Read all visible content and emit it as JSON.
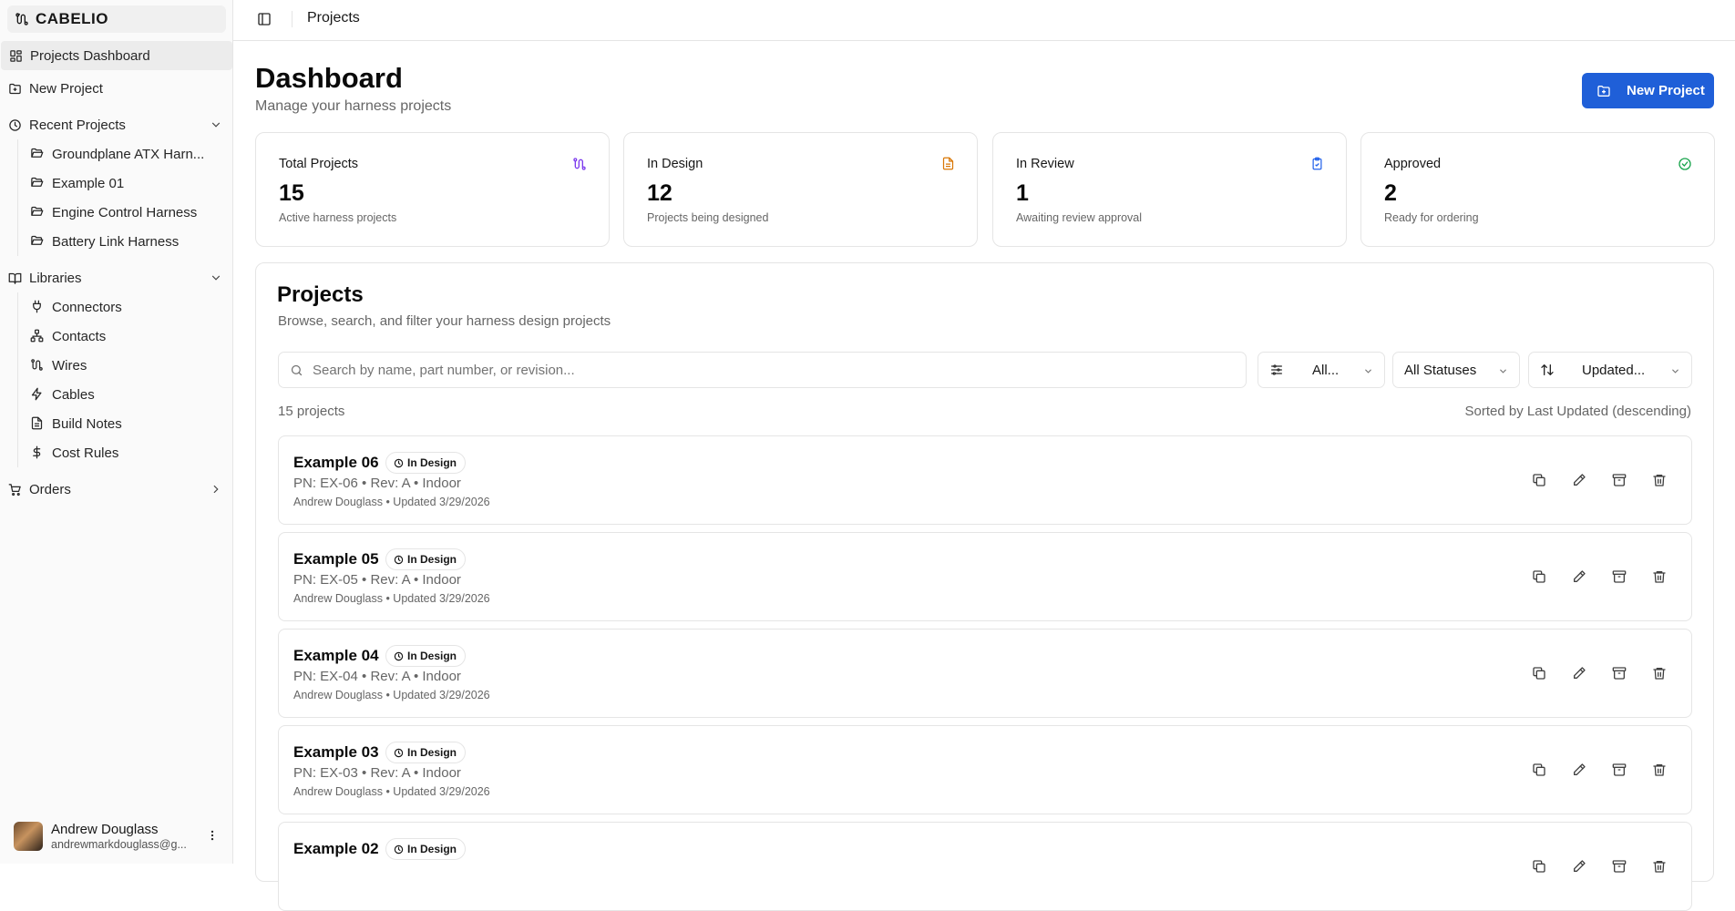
{
  "app": {
    "brand": "CABELIO"
  },
  "sidebar": {
    "nav": {
      "dashboard": "Projects Dashboard",
      "new_project": "New Project",
      "recent": "Recent Projects",
      "libraries": "Libraries",
      "orders": "Orders"
    },
    "recent_projects": [
      "Groundplane ATX Harn...",
      "Example 01",
      "Engine Control Harness",
      "Battery Link Harness"
    ],
    "libraries": [
      "Connectors",
      "Contacts",
      "Wires",
      "Cables",
      "Build Notes",
      "Cost Rules"
    ],
    "user": {
      "name": "Andrew Douglass",
      "email": "andrewmarkdouglass@g..."
    }
  },
  "topbar": {
    "breadcrumb": "Projects"
  },
  "header": {
    "title": "Dashboard",
    "subtitle": "Manage your harness projects",
    "new_button": "New Project"
  },
  "stats": [
    {
      "label": "Total Projects",
      "value": "15",
      "desc": "Active harness projects",
      "icon": "wiring-icon",
      "color": "#7c3aed"
    },
    {
      "label": "In Design",
      "value": "12",
      "desc": "Projects being designed",
      "icon": "document-icon",
      "color": "#d97706"
    },
    {
      "label": "In Review",
      "value": "1",
      "desc": "Awaiting review approval",
      "icon": "clipboard-check-icon",
      "color": "#2563eb"
    },
    {
      "label": "Approved",
      "value": "2",
      "desc": "Ready for ordering",
      "icon": "check-circle-icon",
      "color": "#16a34a"
    }
  ],
  "projects_panel": {
    "title": "Projects",
    "subtitle": "Browse, search, and filter your harness design projects",
    "search_placeholder": "Search by name, part number, or revision...",
    "filter_type": "All...",
    "filter_status": "All Statuses",
    "sort": "Updated...",
    "count": "15 projects",
    "sorted_by": "Sorted by Last Updated (descending)"
  },
  "projects": [
    {
      "name": "Example 06",
      "status": "In Design",
      "meta": "PN: EX-06 • Rev: A • Indoor",
      "footer": "Andrew Douglass • Updated 3/29/2026"
    },
    {
      "name": "Example 05",
      "status": "In Design",
      "meta": "PN: EX-05 • Rev: A • Indoor",
      "footer": "Andrew Douglass • Updated 3/29/2026"
    },
    {
      "name": "Example 04",
      "status": "In Design",
      "meta": "PN: EX-04 • Rev: A • Indoor",
      "footer": "Andrew Douglass • Updated 3/29/2026"
    },
    {
      "name": "Example 03",
      "status": "In Design",
      "meta": "PN: EX-03 • Rev: A • Indoor",
      "footer": "Andrew Douglass • Updated 3/29/2026"
    },
    {
      "name": "Example 02",
      "status": "In Design",
      "meta": "",
      "footer": ""
    }
  ]
}
